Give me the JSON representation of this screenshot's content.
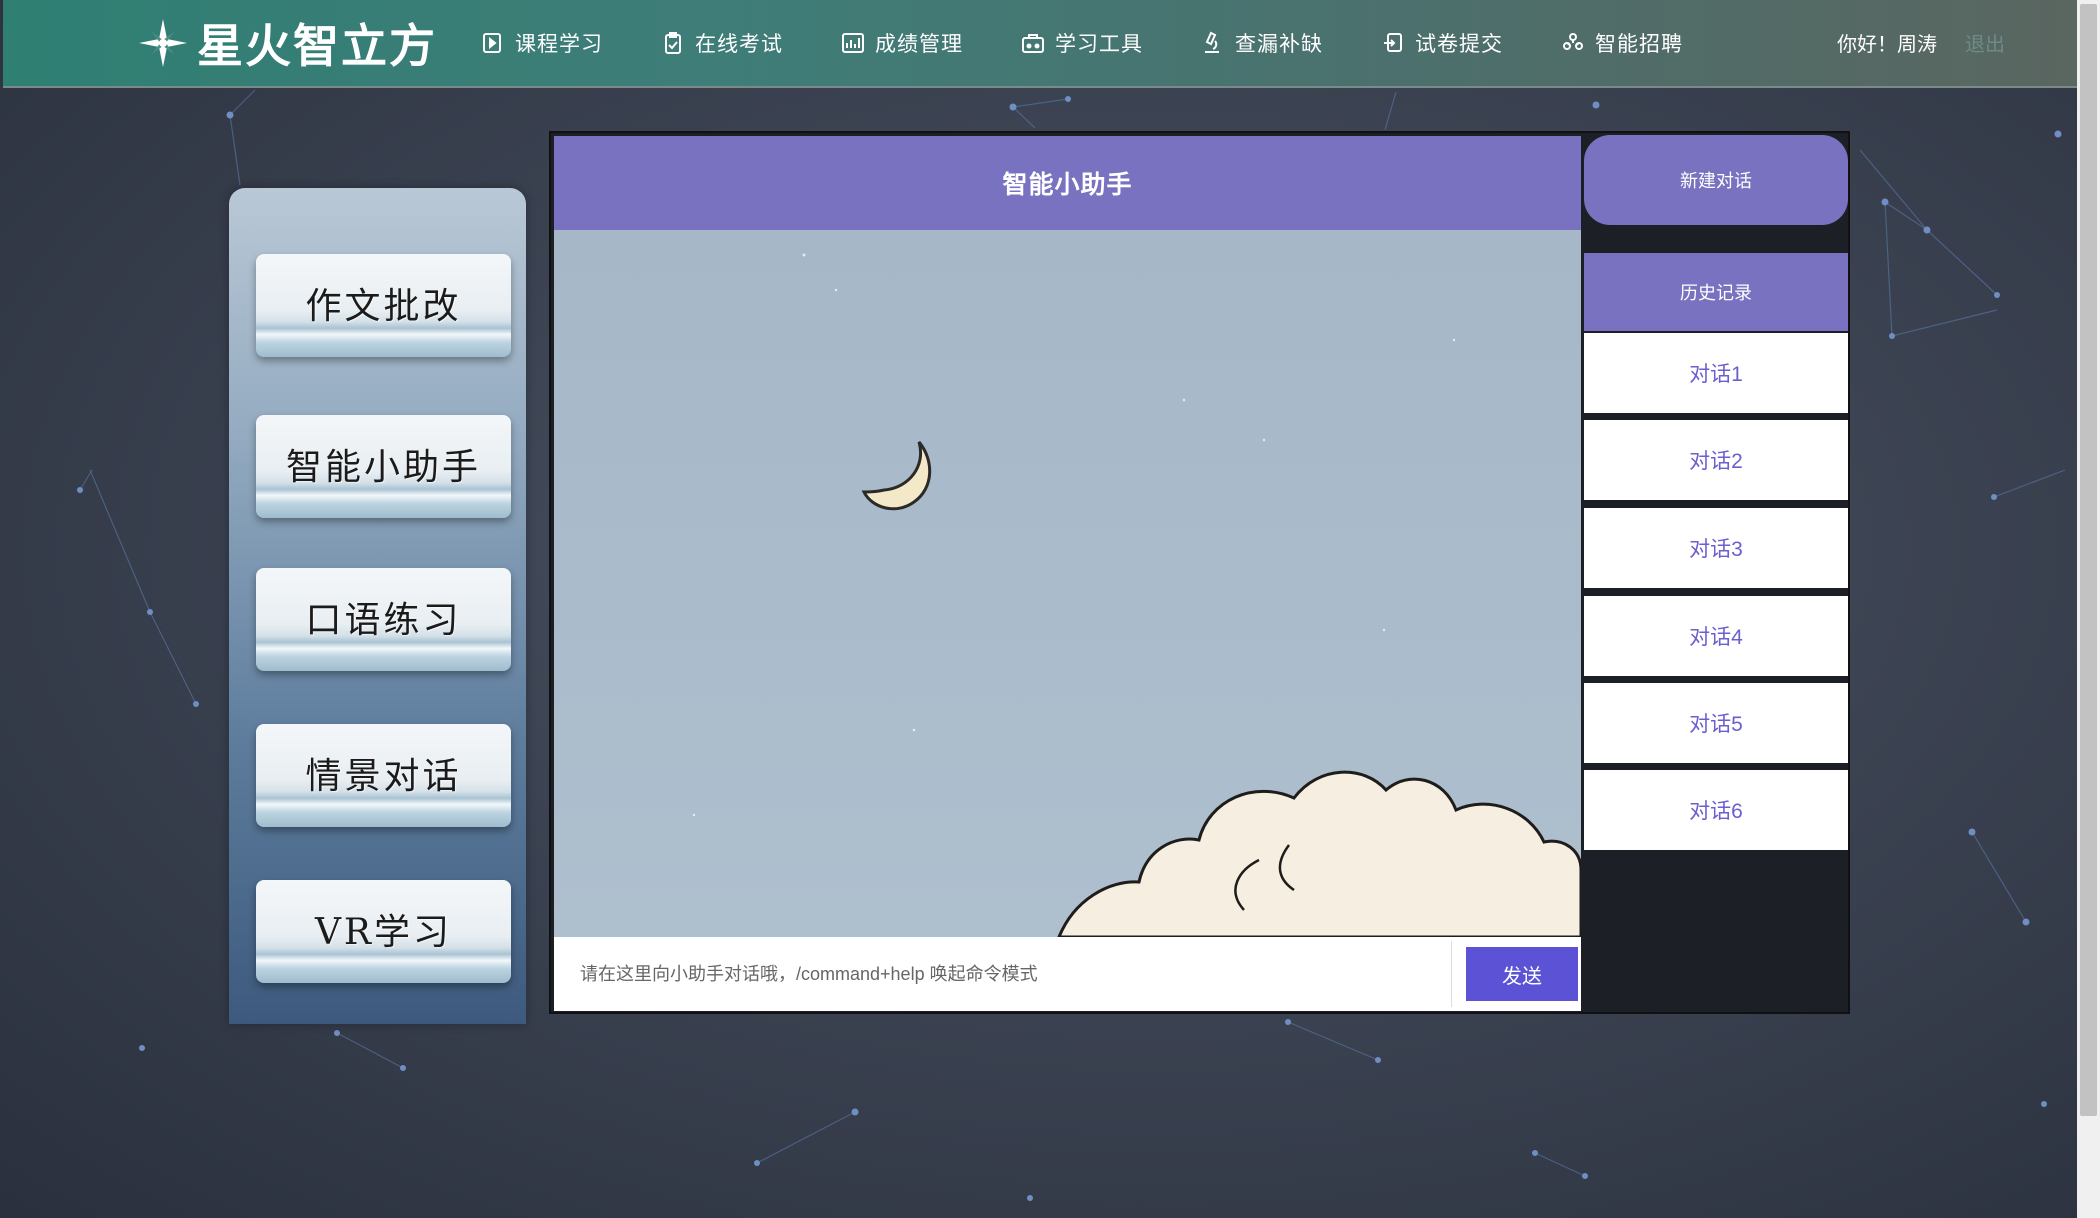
{
  "app": {
    "logo_text": "星火智立方"
  },
  "nav": {
    "items": [
      {
        "label": "课程学习",
        "icon": "play-doc-icon"
      },
      {
        "label": "在线考试",
        "icon": "clipboard-icon"
      },
      {
        "label": "成绩管理",
        "icon": "chart-icon"
      },
      {
        "label": "学习工具",
        "icon": "toolbox-icon"
      },
      {
        "label": "查漏补缺",
        "icon": "microscope-icon"
      },
      {
        "label": "试卷提交",
        "icon": "submit-doc-icon"
      },
      {
        "label": "智能招聘",
        "icon": "people-icon"
      }
    ],
    "greeting": "你好！周涛",
    "logout_label": "退出"
  },
  "left_panel": {
    "buttons": [
      "作文批改",
      "智能小助手",
      "口语练习",
      "情景对话",
      "VR学习"
    ]
  },
  "chat": {
    "title": "智能小助手",
    "input_placeholder": "请在这里向小助手对话哦，/command+help 唤起命令模式",
    "send_label": "发送"
  },
  "sidebar": {
    "new_chat_label": "新建对话",
    "history_label": "历史记录",
    "history": [
      "对话1",
      "对话2",
      "对话3",
      "对话4",
      "对话5",
      "对话6"
    ]
  },
  "colors": {
    "accent": "#7872c0",
    "send_button": "#5b52d6",
    "history_text": "#6a5fd0",
    "topbar_start": "#2f7f73"
  }
}
